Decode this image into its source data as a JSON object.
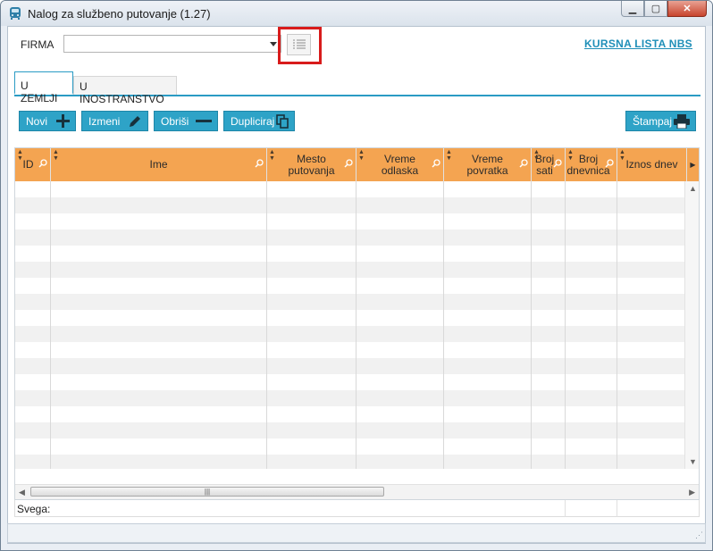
{
  "window": {
    "title": "Nalog za službeno putovanje (1.27)"
  },
  "firma": {
    "label": "FIRMA",
    "value": ""
  },
  "link": {
    "kursna": "KURSNA LISTA NBS"
  },
  "tabs": [
    {
      "label": "U ZEMLJI",
      "active": true
    },
    {
      "label": "U INOSTRANSTVO",
      "active": false
    }
  ],
  "toolbar": {
    "novi": "Novi",
    "izmeni": "Izmeni",
    "obrisi": "Obriši",
    "dupliciraj": "Dupliciraj",
    "stampaj": "Štampaj"
  },
  "grid": {
    "columns": [
      {
        "label": "ID"
      },
      {
        "label": "Ime"
      },
      {
        "label": "Mesto putovanja"
      },
      {
        "label": "Vreme odlaska"
      },
      {
        "label": "Vreme povratka"
      },
      {
        "label": "Broj sati"
      },
      {
        "label": "Broj dnevnica"
      },
      {
        "label": "Iznos dnev"
      }
    ],
    "rows": []
  },
  "footer": {
    "svega": "Svega:"
  },
  "colors": {
    "header": "#f4a451",
    "accent": "#2ea3c7",
    "link": "#1f8fb8"
  }
}
